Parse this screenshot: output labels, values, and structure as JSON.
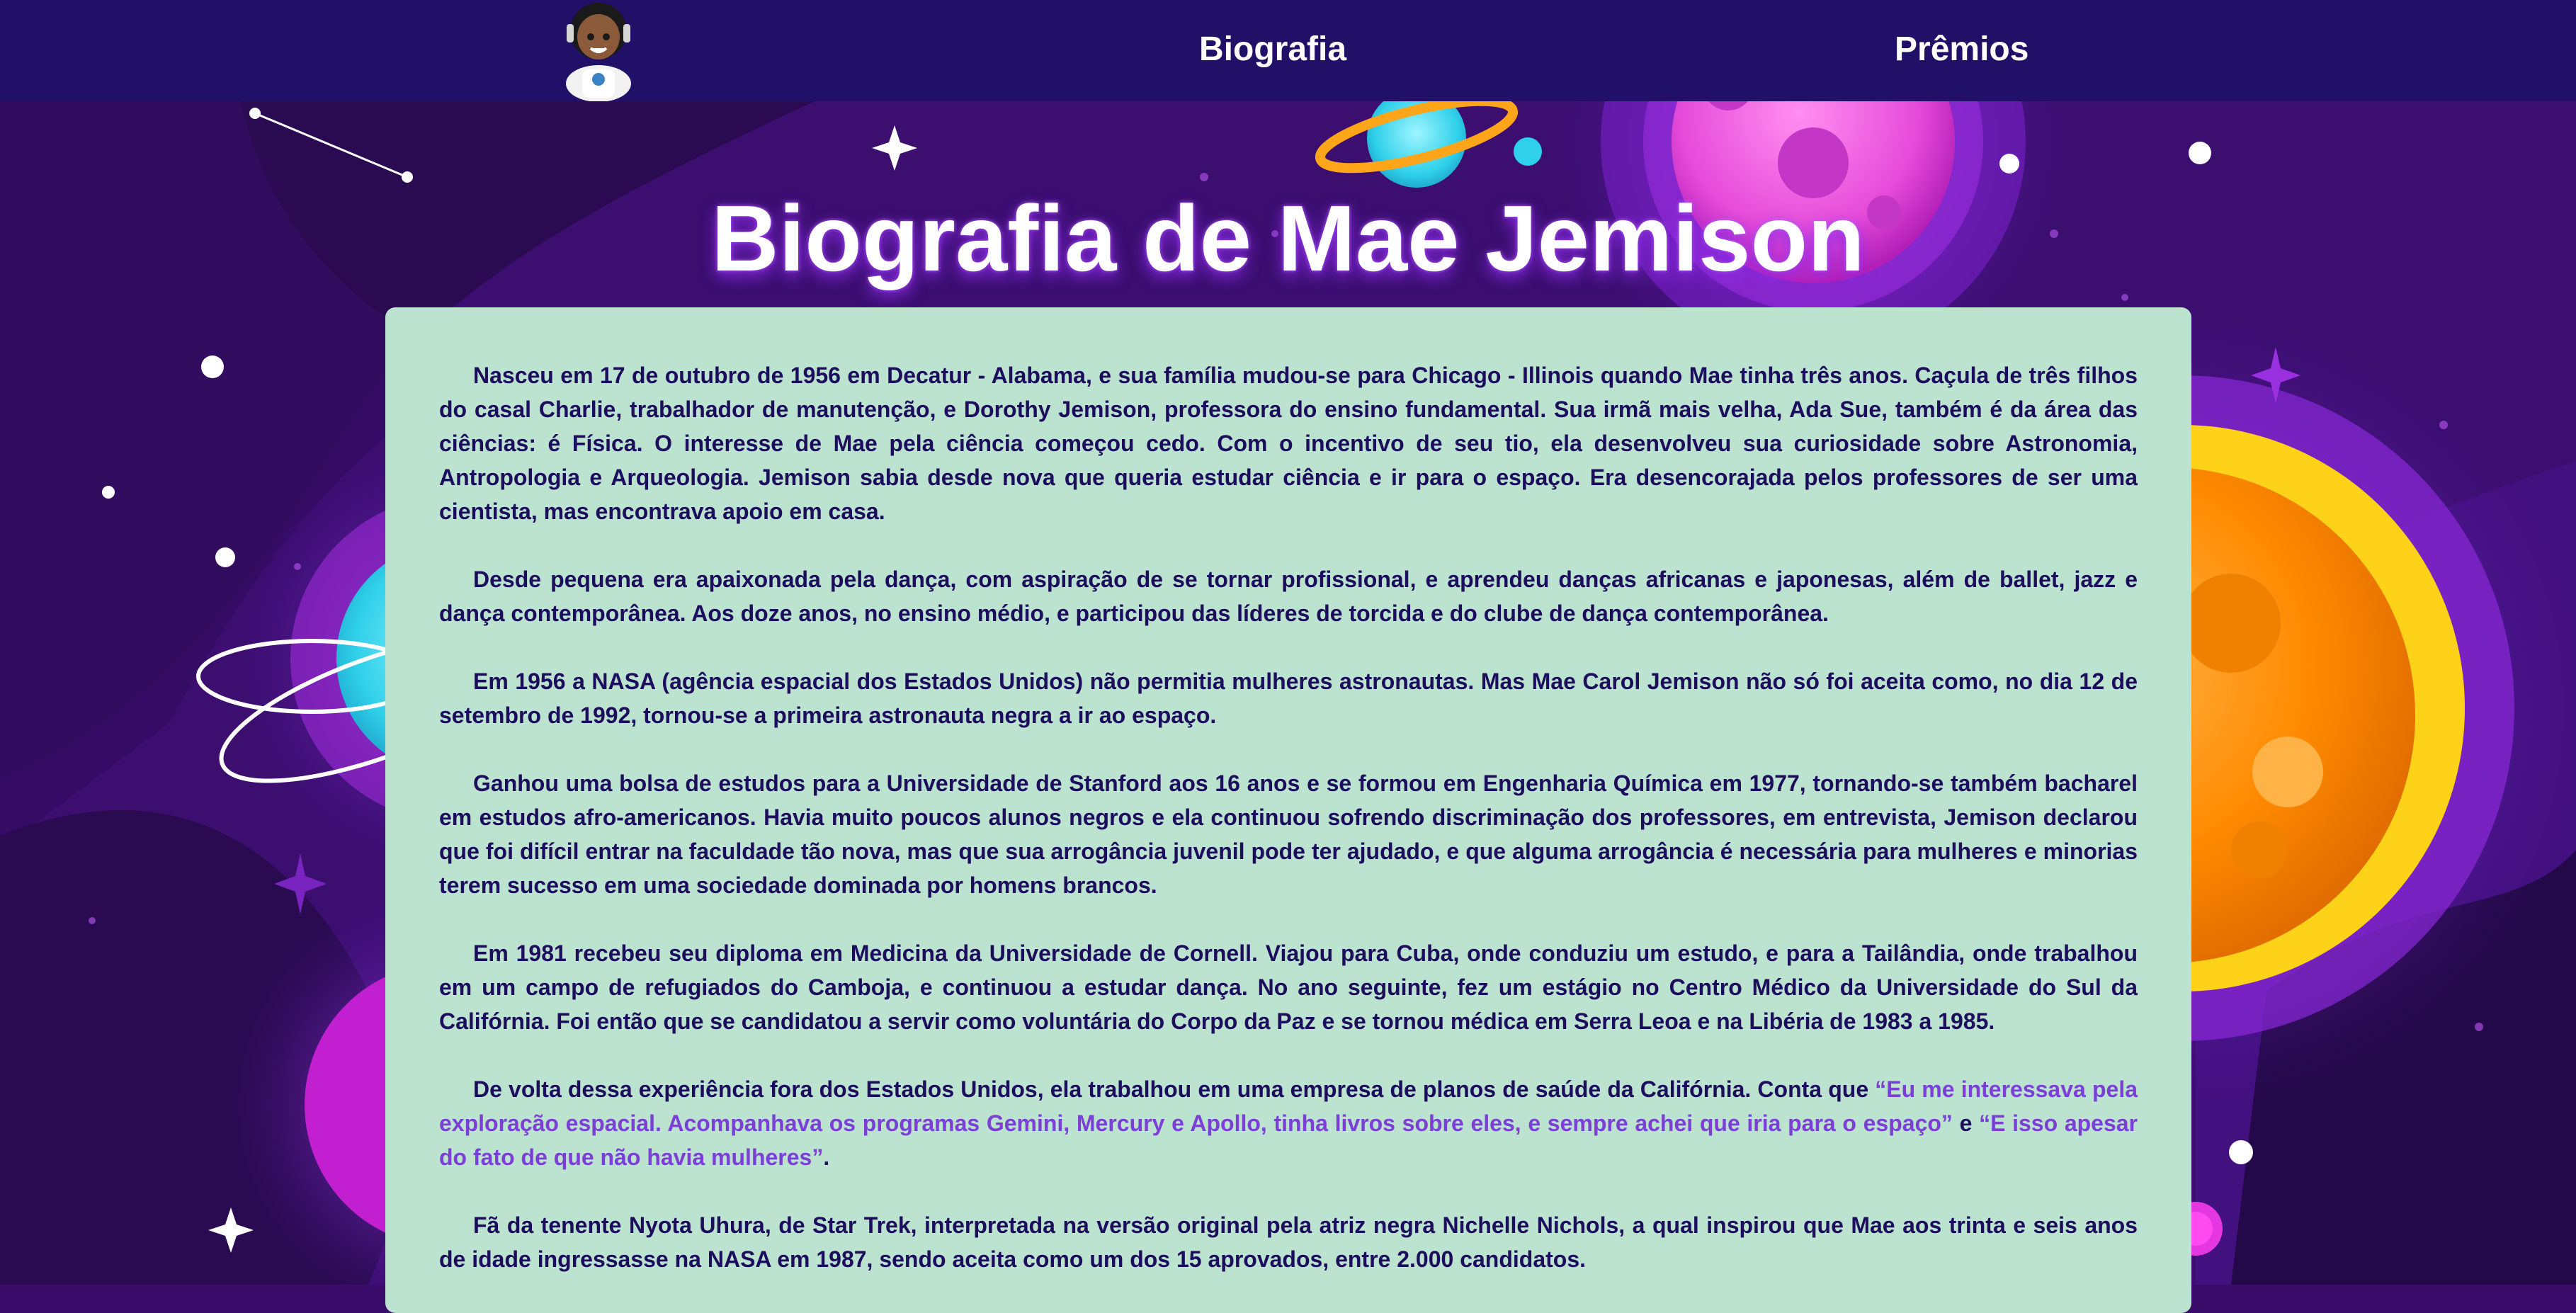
{
  "nav": {
    "logo_label": "Mae Jemison astronaut avatar",
    "links": [
      "Biografia",
      "Prêmios"
    ]
  },
  "page": {
    "title": "Biografia de Mae Jemison"
  },
  "bio": {
    "p1": "Nasceu em 17 de outubro de 1956 em Decatur - Alabama, e sua família mudou-se para Chicago - Illinois quando Mae tinha três anos. Caçula de três filhos do casal Charlie, trabalhador de manutenção, e Dorothy Jemison, professora do ensino fundamental. Sua irmã mais velha, Ada Sue, também é da área das ciências: é Física. O interesse de Mae pela ciência começou cedo. Com o incentivo de seu tio, ela desenvolveu sua curiosidade sobre Astronomia, Antropologia e Arqueologia. Jemison sabia desde nova que queria estudar ciência e ir para o espaço. Era desencorajada pelos professores de ser uma cientista, mas encontrava apoio em casa.",
    "p2": "Desde pequena era apaixonada pela dança, com aspiração de se tornar profissional, e aprendeu danças africanas e japonesas, além de ballet, jazz e dança contemporânea. Aos doze anos, no ensino médio, e participou das líderes de torcida e do clube de dança contemporânea.",
    "p3": "Em 1956 a NASA (agência espacial dos Estados Unidos) não permitia mulheres astronautas. Mas Mae Carol Jemison não só foi aceita como, no dia 12 de setembro de 1992, tornou-se a primeira astronauta negra a ir ao espaço.",
    "p4": "Ganhou uma bolsa de estudos para a Universidade de Stanford aos 16 anos e se formou em Engenharia Química em 1977, tornando-se também bacharel em estudos afro-americanos. Havia muito poucos alunos negros e ela continuou sofrendo discriminação dos professores, em entrevista, Jemison declarou que foi difícil entrar na faculdade tão nova, mas que sua arrogância juvenil pode ter ajudado, e que alguma arrogância é necessária para mulheres e minorias terem sucesso em uma sociedade dominada por homens brancos.",
    "p5": "Em 1981 recebeu seu diploma em Medicina da Universidade de Cornell. Viajou para Cuba, onde conduziu um estudo, e para a Tailândia, onde trabalhou em um campo de refugiados do Camboja, e continuou a estudar dança. No ano seguinte, fez um estágio no Centro Médico da Universidade do Sul da Califórnia. Foi então que se candidatou a servir como voluntária do Corpo da Paz e se tornou médica em Serra Leoa e na Libéria de 1983 a 1985.",
    "p6_intro": "De volta dessa experiência fora dos Estados Unidos, ela trabalhou em uma empresa de planos de saúde da Califórnia. Conta que ",
    "p6_quote1": "“Eu me interessava pela exploração espacial. Acompanhava os programas Gemini, Mercury e Apollo, tinha livros sobre eles, e sempre achei que iria para o espaço”",
    "p6_mid": " e ",
    "p6_quote2": "“E isso apesar do fato de que não havia mulheres”",
    "p6_end": ".",
    "p7": "Fã da tenente Nyota Uhura, de Star Trek, interpretada na versão original pela atriz negra Nichelle Nichols, a qual inspirou que Mae aos trinta e seis anos de idade ingressasse na NASA em 1987, sendo aceita como um dos 15 aprovados, entre 2.000 candidatos."
  },
  "colors": {
    "nav_bg": "#201068",
    "card_bg": "#bce3cf",
    "text": "#1c0e5c",
    "quote": "#7b3fd6",
    "space_dark": "#2a0b52"
  },
  "icons": [
    "astronaut-avatar-icon",
    "sparkle-icon"
  ]
}
